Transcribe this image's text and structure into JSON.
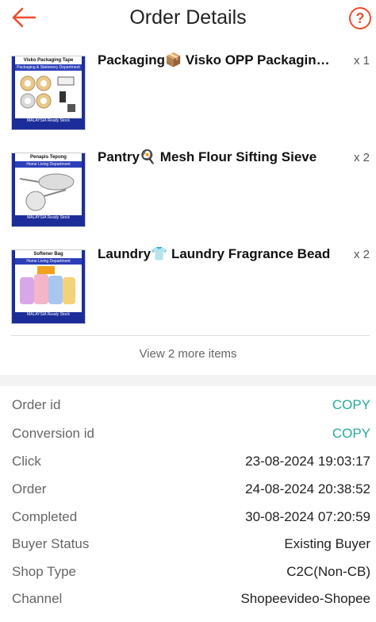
{
  "header": {
    "title": "Order Details",
    "help_glyph": "?"
  },
  "items": [
    {
      "name": "Packaging📦 Visko OPP Packaging Tape",
      "qty": "x 1",
      "thumb": {
        "heading": "Visko Packaging Tape",
        "band": "Packaging & Stationery Department",
        "footer": "MALAYSIA Ready Stock"
      }
    },
    {
      "name": "Pantry🍳 Mesh Flour Sifting Sieve",
      "qty": "x 2",
      "thumb": {
        "heading": "Penapis Tepung",
        "band": "Home Living Department",
        "footer": "MALAYSIA Ready Stock"
      }
    },
    {
      "name": "Laundry👕 Laundry Fragrance Bead",
      "qty": "x 2",
      "thumb": {
        "heading": "Softener Bag",
        "band": "Home Living Department",
        "footer": "MALAYSIA Ready Stock"
      }
    }
  ],
  "more_items": "View 2 more items",
  "details": [
    {
      "label": "Order id",
      "value": "COPY",
      "is_copy": true
    },
    {
      "label": "Conversion id",
      "value": "COPY",
      "is_copy": true
    },
    {
      "label": "Click",
      "value": "23-08-2024 19:03:17"
    },
    {
      "label": "Order",
      "value": "24-08-2024 20:38:52"
    },
    {
      "label": "Completed",
      "value": "30-08-2024 07:20:59"
    },
    {
      "label": "Buyer Status",
      "value": "Existing Buyer"
    },
    {
      "label": "Shop Type",
      "value": "C2C(Non-CB)"
    },
    {
      "label": "Channel",
      "value": "Shopeevideo-Shopee"
    }
  ],
  "colors": {
    "accent": "#ee4d2d",
    "copy": "#26aa99",
    "thumb_blue": "#1c2d9a"
  },
  "icons": {
    "back": "arrow-left-icon",
    "help": "question-circle-icon"
  }
}
